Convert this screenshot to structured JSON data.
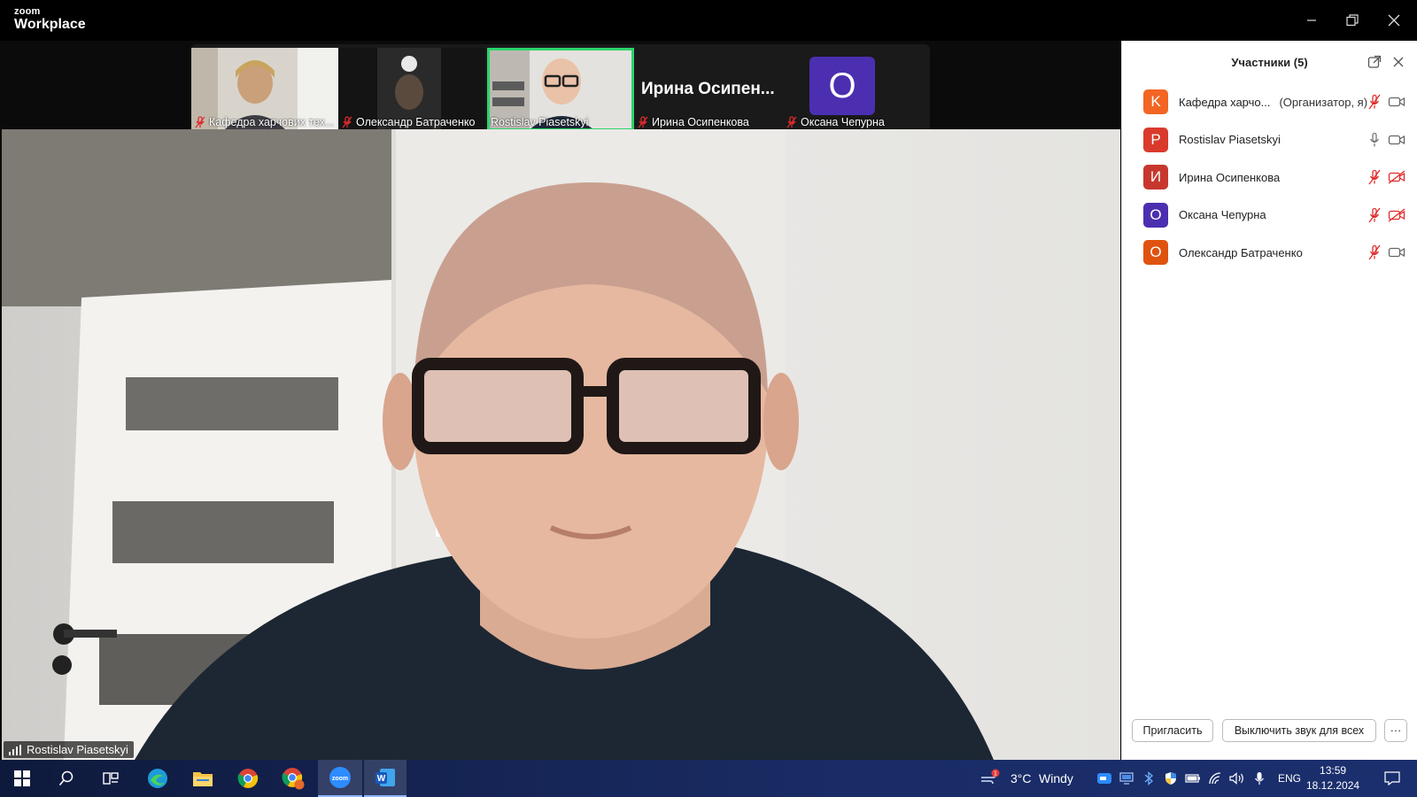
{
  "app": {
    "logo_top": "zoom",
    "logo_bottom": "Workplace"
  },
  "thumbnails": [
    {
      "name": "Кафедра харчових тех...",
      "muted": true
    },
    {
      "name": "Олександр Батраченко",
      "muted": true
    },
    {
      "name": "Rostislav Piasetskyi",
      "muted": false,
      "active": true
    },
    {
      "name": "Ирина Осипенкова",
      "muted": true,
      "display_name": "Ирина  Осипен..."
    },
    {
      "name": "Оксана Чепурна",
      "muted": true,
      "avatar": "O"
    }
  ],
  "main_video": {
    "speaker": "Rostislav Piasetskyi"
  },
  "panel": {
    "title": "Участники (5)",
    "participants": [
      {
        "initial": "K",
        "name": "Кафедра харчо...",
        "role": "(Организатор, я)",
        "color": "#f26522",
        "mic": "muted",
        "cam": "on"
      },
      {
        "initial": "P",
        "name": "Rostislav Piasetskyi",
        "role": "",
        "color": "#d93a2b",
        "mic": "on",
        "cam": "on"
      },
      {
        "initial": "И",
        "name": "Ирина Осипенкова",
        "role": "",
        "color": "#c8372d",
        "mic": "muted",
        "cam": "off"
      },
      {
        "initial": "O",
        "name": "Оксана Чепурна",
        "role": "",
        "color": "#4b2fb0",
        "mic": "muted",
        "cam": "off"
      },
      {
        "initial": "O",
        "name": "Олександр Батраченко",
        "role": "",
        "color": "#e0520f",
        "mic": "muted",
        "cam": "on"
      }
    ],
    "invite_label": "Пригласить",
    "mute_all_label": "Выключить звук для всех",
    "more_label": "···"
  },
  "taskbar": {
    "weather_temp": "3°C",
    "weather_desc": "Windy",
    "weather_badge": "1",
    "lang": "ENG",
    "time": "13:59",
    "date": "18.12.2024",
    "zoom_icon_text": "zoom",
    "word_icon_text": "W"
  },
  "colors": {
    "active_border": "#2bd46a",
    "muted_red": "#e02b2b"
  }
}
